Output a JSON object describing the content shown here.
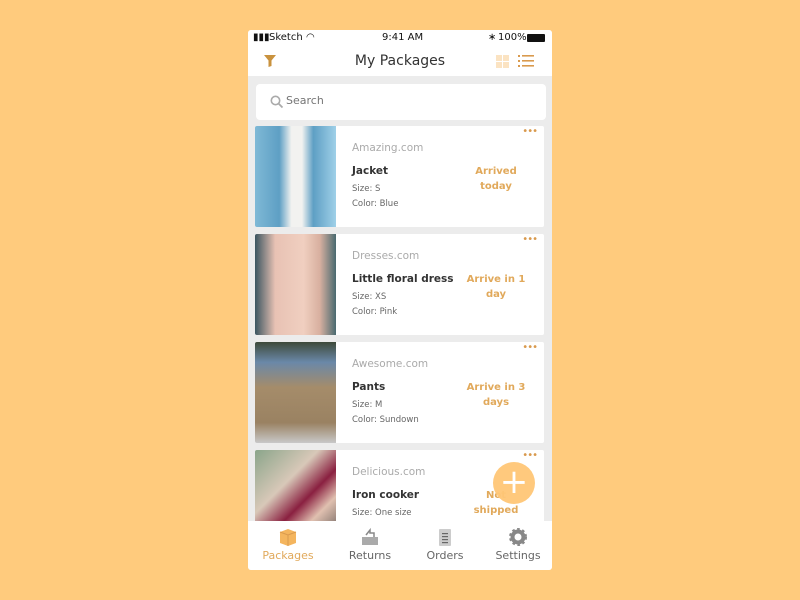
{
  "status_bar": {
    "carrier": "Sketch",
    "time": "9:41 AM",
    "battery": "100%"
  },
  "header": {
    "title": "My Packages",
    "icons": [
      "filter-icon",
      "grid-view-icon",
      "list-view-icon"
    ]
  },
  "search": {
    "placeholder": "Search"
  },
  "packages": [
    {
      "store": "Amazing.com",
      "name": "Jacket",
      "size": "Size: S",
      "color": "Color: Blue",
      "status": "Arrived today"
    },
    {
      "store": "Dresses.com",
      "name": "Little floral dress",
      "size": "Size: XS",
      "color": "Color: Pink",
      "status": "Arrive in 1 day"
    },
    {
      "store": "Awesome.com",
      "name": "Pants",
      "size": "Size: M",
      "color": "Color: Sundown",
      "status": "Arrive in 3 days"
    },
    {
      "store": "Delicious.com",
      "name": "Iron cooker",
      "size": "Size: One size",
      "color": "",
      "status": "Not shipped"
    }
  ],
  "fab": {
    "label": "+"
  },
  "tabs": [
    {
      "label": "Packages",
      "active": true
    },
    {
      "label": "Returns"
    },
    {
      "label": "Orders"
    },
    {
      "label": "Settings"
    }
  ],
  "colors": {
    "accent": "#E1A95B",
    "background": "#FFCB7D"
  }
}
